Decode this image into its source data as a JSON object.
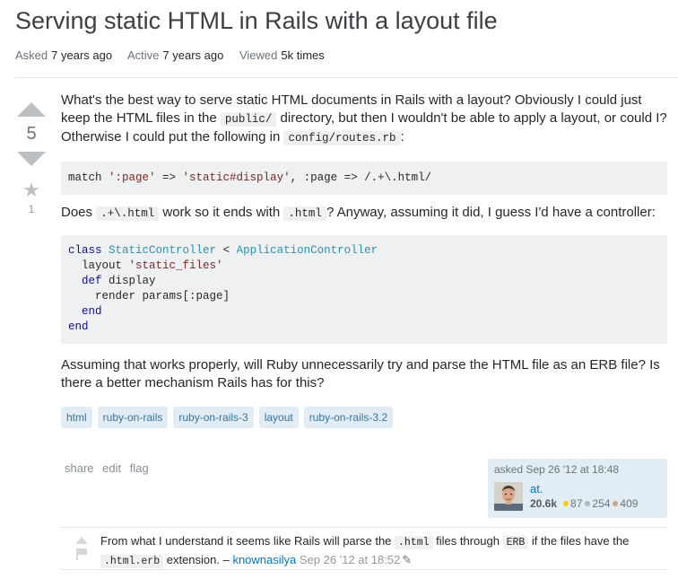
{
  "question": {
    "title": "Serving static HTML in Rails with a layout file",
    "meta": {
      "asked_label": "Asked",
      "asked_value": "7 years ago",
      "active_label": "Active",
      "active_value": "7 years ago",
      "viewed_label": "Viewed",
      "viewed_value": "5k times"
    },
    "votes": "5",
    "favorites": "1",
    "body": {
      "p1_a": "What's the best way to serve static HTML documents in Rails with a layout? Obviously I could just keep the HTML files in the ",
      "p1_code1": "public/",
      "p1_b": " directory, but then I wouldn't be able to apply a layout, or could I? Otherwise I could put the following in ",
      "p1_code2": "config/routes.rb",
      "p1_c": ":",
      "code1": {
        "l1_a": "match ",
        "l1_s1": "':page'",
        "l1_b": " => ",
        "l1_s2": "'static#display'",
        "l1_c": ", :page => /.+\\.html/"
      },
      "p2_a": "Does ",
      "p2_code1": ".+\\.html",
      "p2_b": " work so it ends with ",
      "p2_code2": ".html",
      "p2_c": "? Anyway, assuming it did, I guess I'd have a controller:",
      "code2": {
        "l1_kw": "class",
        "l1_cls": "StaticController",
        "l1_op": " < ",
        "l1_cls2": "ApplicationController",
        "l2_a": "  layout ",
        "l2_str": "'static_files'",
        "l3_kw": "  def",
        "l3_b": " display",
        "l4": "    render params[:page]",
        "l5_kw": "  end",
        "l6_kw": "end"
      },
      "p3": "Assuming that works properly, will Ruby unnecessarily try and parse the HTML file as an ERB file? Is there a better mechanism Rails has for this?"
    },
    "tags": [
      "html",
      "ruby-on-rails",
      "ruby-on-rails-3",
      "layout",
      "ruby-on-rails-3.2"
    ],
    "post_menu": {
      "share": "share",
      "edit": "edit",
      "flag": "flag"
    },
    "owner": {
      "asked_text": "asked Sep 26 '12 at 18:48",
      "name": "at.",
      "reputation": "20.6k",
      "gold": "87",
      "silver": "254",
      "bronze": "409",
      "badge_colors": {
        "gold": "#ffcc01",
        "silver": "#b4b8bc",
        "bronze": "#d1a684"
      }
    },
    "comment": {
      "text_a": "From what I understand it seems like Rails will parse the ",
      "code1": ".html",
      "text_b": " files through ",
      "code2": "ERB",
      "text_c": " if the files have the ",
      "code3": ".html.erb",
      "text_d": " extension. – ",
      "user": "knownasilya",
      "date": "Sep 26 '12 at 18:52"
    }
  }
}
